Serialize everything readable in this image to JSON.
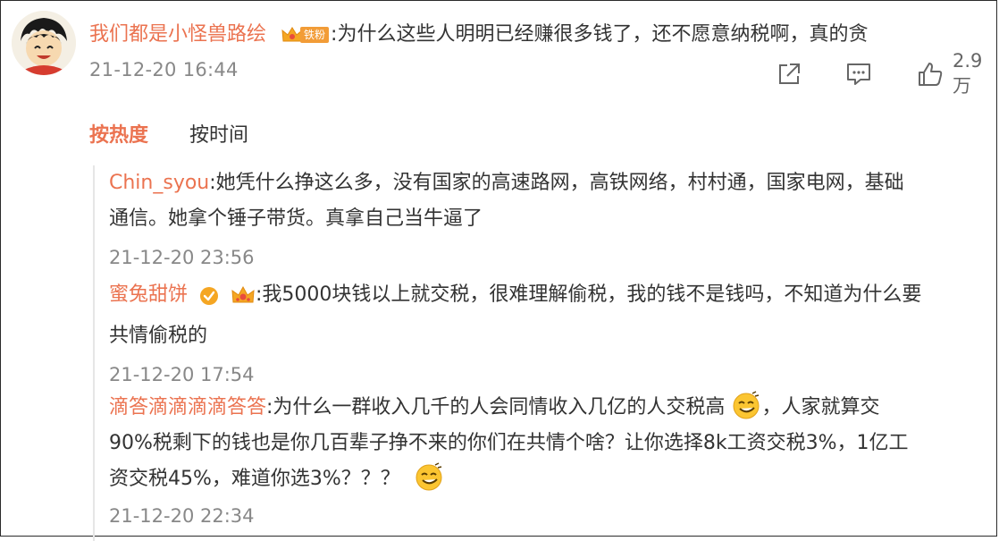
{
  "post": {
    "username": "我们都是小怪兽路绘",
    "fan_label": "铁粉",
    "text": ":为什么这些人明明已经赚很多钱了，还不愿意纳税啊，真的贪",
    "time": "21-12-20 16:44",
    "like_count": "2.9万"
  },
  "sort": {
    "hot": "按热度",
    "time": "按时间"
  },
  "comments": [
    {
      "username": "Chin_syou",
      "line1": ":她凭什么挣这么多，没有国家的高速路网，高铁网络，村村通，国家电网，基础",
      "line2": "通信。她拿个锤子带货。真拿自己当牛逼了",
      "time": "21-12-20 23:56"
    },
    {
      "username": "蜜兔甜饼",
      "line1": ":我5000块钱以上就交税，很难理解偷税，我的钱不是钱吗，不知道为什么要",
      "line2": "共情偷税的",
      "time": "21-12-20 17:54"
    },
    {
      "username": "滴答滴滴滴滴答答",
      "line1a": ":为什么一群收入几千的人会同情收入几亿的人交税高",
      "line1b": "，人家就算交",
      "line2": "90%税剩下的钱也是你几百辈子挣不来的你们在共情个啥？让你选择8k工资交税3%，1亿工",
      "line3": "资交税45%，难道你选3%？？？",
      "time": "21-12-20 22:34"
    }
  ],
  "icons": {
    "share": "share-icon",
    "comment": "comment-icon",
    "like": "thumbs-up-icon",
    "verified": "verified-badge-icon",
    "crown": "crown-icon",
    "emoji": "smirk-emoji-icon"
  },
  "colors": {
    "username": "#eb7350",
    "fan_badge": "#f29c37",
    "verified": "#f5a623",
    "meta_text": "#888888"
  }
}
